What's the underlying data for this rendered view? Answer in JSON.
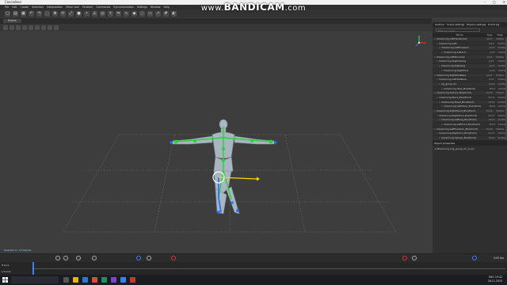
{
  "window": {
    "title": "Cascadeur"
  },
  "watermark": {
    "prefix": "www.",
    "brand": "BANDICAM",
    "suffix": ".com"
  },
  "menu": [
    "File",
    "Edit",
    "Create",
    "Selection",
    "Interpolation",
    "Mirror tool",
    "Timeline",
    "Commands",
    "Synchronization",
    "Settings",
    "Window",
    "Help"
  ],
  "viewport_tab": "Scene",
  "viewport_status": "Selected 0 / 70 objects",
  "outliner": {
    "tabs": [
      "Outliner",
      "Scene settings",
      "Physics settings",
      "Event log"
    ],
    "search_placeholder": "Filter by name",
    "columns": {
      "name": "Name",
      "a": "Type",
      "b": "Flags"
    },
    "rows": [
      {
        "name": "• mixamorig:LeftHandIndex",
        "a": "Joint",
        "b": "Visible"
      },
      {
        "name": "• mixamorig:Left...",
        "a": "Joint",
        "b": "Visible"
      },
      {
        "name": "• mixamorig:LeftForeArm",
        "a": "Joint",
        "b": "Visible"
      },
      {
        "name": "• mixamorig:LeftArm",
        "a": "Joint",
        "b": "Visible"
      },
      {
        "name": "• mixamorig:LeftShoulder",
        "a": "Joint",
        "b": "Visible"
      },
      {
        "name": "• mixamorig:RightUpLeg",
        "a": "Joint",
        "b": "Visible"
      },
      {
        "name": "• mixamorig:RightLeg",
        "a": "Joint",
        "b": "Visible"
      },
      {
        "name": "• mixamorig:RightFoot",
        "a": "Joint",
        "b": "Visible"
      },
      {
        "name": "• mixamorig:RightToeBase",
        "a": "Joint",
        "b": "Visible"
      },
      {
        "name": "• mixamorig:LeftToeBase",
        "a": "Joint",
        "b": "Visible"
      },
      {
        "name": "• rig_group_01",
        "a": "Point",
        "b": "Visible"
      },
      {
        "name": "• mixamorig:Hips_Box(Point)",
        "a": "Point",
        "b": "Visible"
      },
      {
        "name": "• mixamorig:Spine1_Box(Point)",
        "a": "Point",
        "b": "Visible"
      },
      {
        "name": "• mixamorig:Neck_Box(Point)",
        "a": "Point",
        "b": "Visible"
      },
      {
        "name": "• mixamorig:Head_Box(Point)",
        "a": "Point",
        "b": "Visible"
      },
      {
        "name": "• mixamorig:LeftHand_Box(Point)",
        "a": "Point",
        "b": "Visible"
      },
      {
        "name": "• mixamorig:RightHand_Box(Point)",
        "a": "Point",
        "b": "Visible"
      },
      {
        "name": "• mixamorig:RightFoot_Box(Point)",
        "a": "Point",
        "b": "Visible"
      },
      {
        "name": "• mixamorig:LeftLeg_Box(Point)",
        "a": "Point",
        "b": "Visible"
      },
      {
        "name": "• mixamorig:LeftFoot_Box(Point)",
        "a": "Point",
        "b": "Visible"
      },
      {
        "name": "• mixamorig:LeftForeArm_Box(Point)",
        "a": "Point",
        "b": "Visible"
      },
      {
        "name": "• mixamorig:RightArm_Box(Point)",
        "a": "Point",
        "b": "Visible"
      },
      {
        "name": "• mixamorig:Spine2_Box(Point)",
        "a": "Point",
        "b": "Visible"
      },
      {
        "name": "• mixamorig:Spine_Box(Point)",
        "a": "Point",
        "b": "Visible"
      },
      {
        "name": "• mixamorig:RightHand_Box(Point)",
        "a": "Point",
        "b": "Visible"
      },
      {
        "name": "• mixamorig:LeftHand_Box(Point)",
        "a": "Point",
        "b": "Visible"
      },
      {
        "name": "• mixamorig:Hips_Box(Point)",
        "a": "Point",
        "b": "Visible"
      }
    ]
  },
  "properties": {
    "title": "Object properties",
    "item": "▸ Mixamorig (rig_group_01_1) (0)",
    "footer": "Number of selected objects: 1"
  },
  "timeline": {
    "tracks_label": "Tracks",
    "scene_label": "▸ Scene",
    "time_value": "0:00 fps"
  },
  "taskbar": {
    "time": "19:42",
    "date": "28.11.2020",
    "lang": "ENG"
  },
  "colors": {
    "bone_green": "#2fcf3a",
    "joint_blue": "#2b6fff",
    "accent_yellow": "#ffd400",
    "playhead": "#3a7dff",
    "record_red": "#e03030"
  }
}
